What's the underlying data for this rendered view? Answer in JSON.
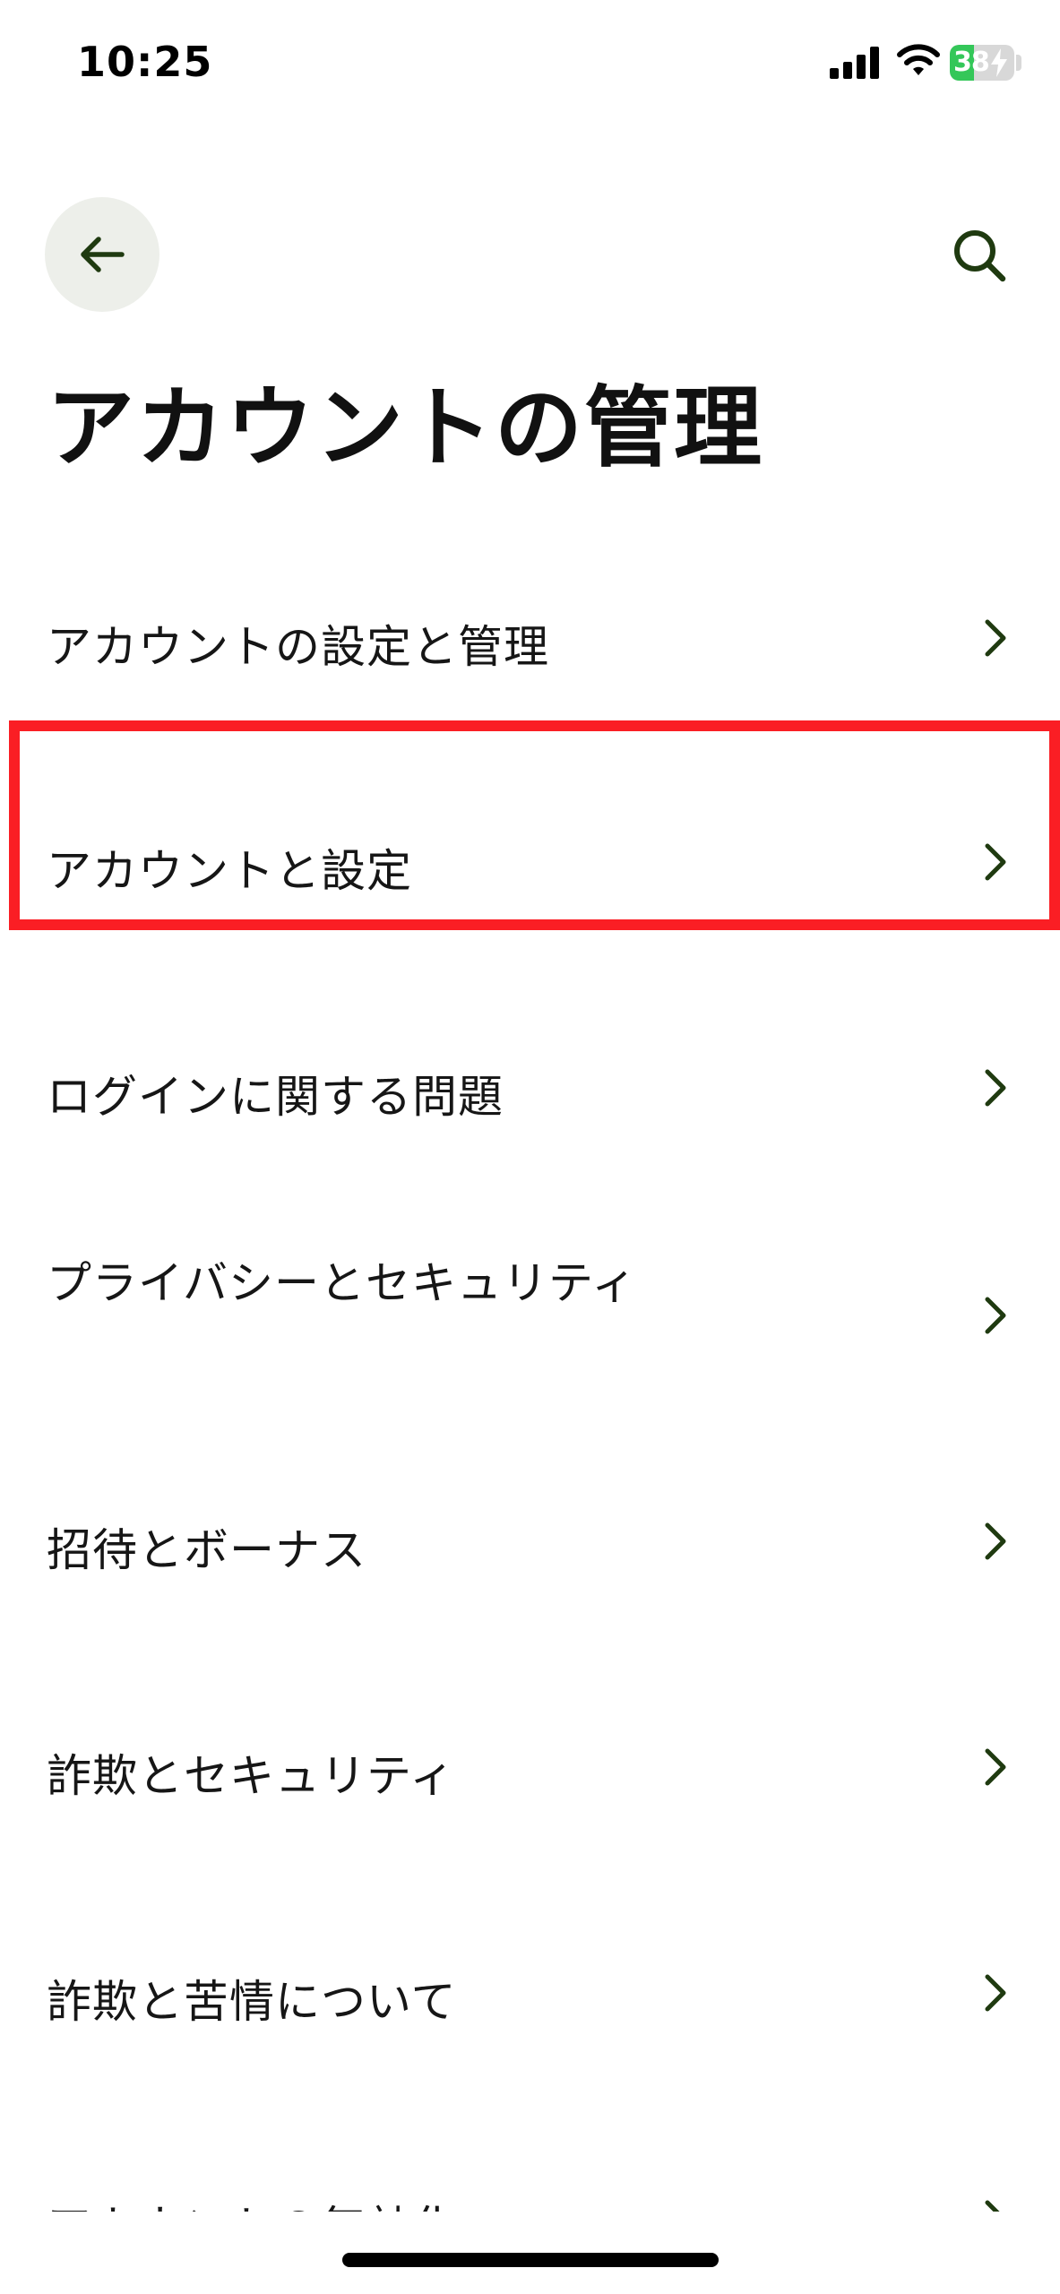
{
  "status_bar": {
    "time": "10:25",
    "battery_level": "38",
    "battery_fraction": 0.38,
    "icons": [
      "signal-icon",
      "wifi-icon",
      "battery-icon",
      "charging-bolt-icon"
    ]
  },
  "nav": {
    "back_icon": "arrow-left-icon",
    "search_icon": "search-icon"
  },
  "page": {
    "title": "アカウントの管理"
  },
  "menu": {
    "items": [
      {
        "label": "アカウントの設定と管理"
      },
      {
        "label": "アカウントと設定",
        "highlighted": true
      },
      {
        "label": "ログインに関する問題"
      },
      {
        "label": "プライバシーとセキュリティ"
      },
      {
        "label": "招待とボーナス"
      },
      {
        "label": "詐欺とセキュリティ"
      },
      {
        "label": "詐欺と苦情について"
      },
      {
        "label": "アカウントの無効化"
      }
    ]
  },
  "colors": {
    "accent_dark_green": "#1f3a10",
    "back_button_bg": "#edefea",
    "highlight_red": "#fa1e24",
    "battery_green": "#34c759"
  }
}
